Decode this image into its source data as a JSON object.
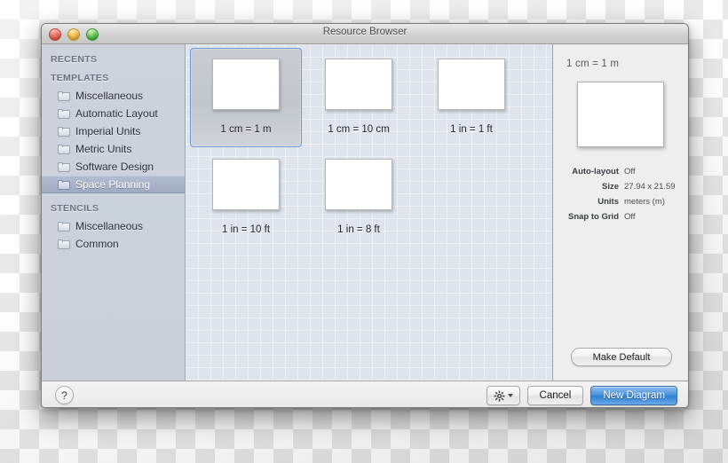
{
  "window": {
    "title": "Resource Browser",
    "traffic_lights": [
      "close-button",
      "minimize-button",
      "zoom-button"
    ]
  },
  "sidebar": {
    "groups": [
      {
        "title": "RECENTS",
        "items": []
      },
      {
        "title": "TEMPLATES",
        "items": [
          {
            "label": "Miscellaneous",
            "selected": false
          },
          {
            "label": "Automatic Layout",
            "selected": false
          },
          {
            "label": "Imperial Units",
            "selected": false
          },
          {
            "label": "Metric Units",
            "selected": false
          },
          {
            "label": "Software Design",
            "selected": false
          },
          {
            "label": "Space Planning",
            "selected": true
          }
        ]
      },
      {
        "title": "STENCILS",
        "items": [
          {
            "label": "Miscellaneous",
            "selected": false
          },
          {
            "label": "Common",
            "selected": false
          }
        ]
      }
    ]
  },
  "content": {
    "tiles": [
      {
        "label": "1 cm = 1 m",
        "selected": true
      },
      {
        "label": "1 cm = 10 cm",
        "selected": false
      },
      {
        "label": "1 in = 1 ft",
        "selected": false
      },
      {
        "label": "1 in = 10 ft",
        "selected": false
      },
      {
        "label": "1 in = 8 ft",
        "selected": false
      }
    ]
  },
  "inspector": {
    "title": "1 cm = 1 m",
    "properties": [
      {
        "key": "Auto-layout",
        "value": "Off"
      },
      {
        "key": "Size",
        "value": "27.94 x 21.59"
      },
      {
        "key": "Units",
        "value": "meters (m)"
      },
      {
        "key": "Snap to Grid",
        "value": "Off"
      }
    ],
    "make_default_label": "Make Default"
  },
  "footer": {
    "help_label": "?",
    "action_menu_icon": "gear-icon",
    "cancel_label": "Cancel",
    "primary_label": "New Diagram"
  },
  "colors": {
    "accent": "#3f8fdc",
    "selection": "#9fabc2",
    "sidebar_bg": "#ccd2dc",
    "content_bg": "#dfe3ec"
  }
}
